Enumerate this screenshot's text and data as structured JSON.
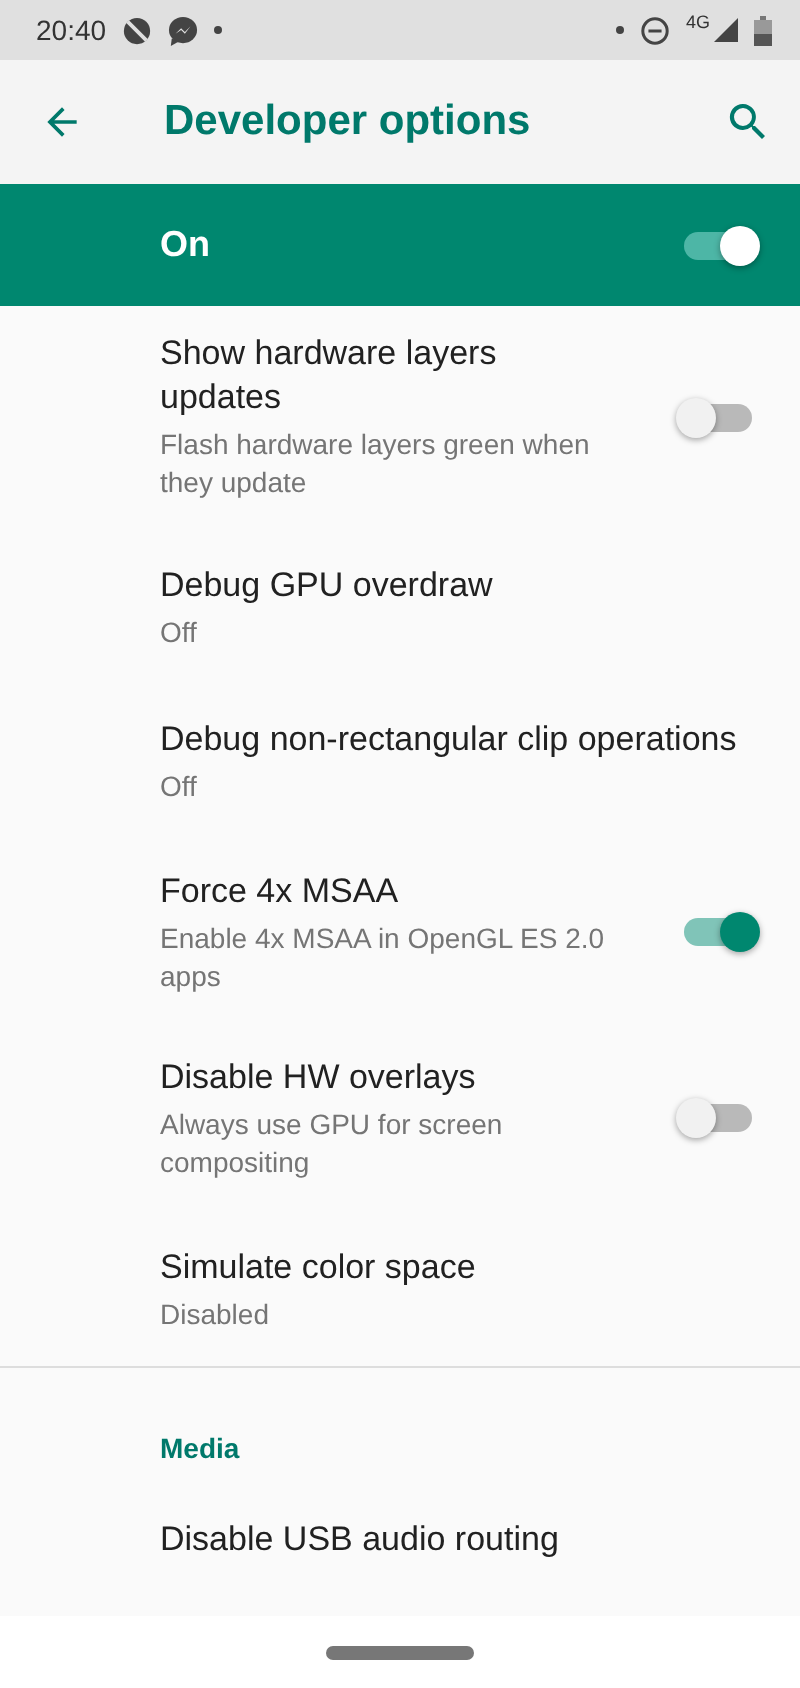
{
  "status_bar": {
    "time": "20:40",
    "network": "4G"
  },
  "toolbar": {
    "title": "Developer options"
  },
  "master_switch": {
    "label": "On",
    "on": true
  },
  "items": [
    {
      "kind": "switch",
      "title": "Show hardware layers updates",
      "summary": "Flash hardware layers green when they update",
      "on": false
    },
    {
      "kind": "plain",
      "title": "Debug GPU overdraw",
      "summary": "Off"
    },
    {
      "kind": "plain",
      "title": "Debug non-rectangular clip operations",
      "summary": "Off"
    },
    {
      "kind": "switch",
      "title": "Force 4x MSAA",
      "summary": "Enable 4x MSAA in OpenGL ES 2.0 apps",
      "on": true
    },
    {
      "kind": "switch",
      "title": "Disable HW overlays",
      "summary": "Always use GPU for screen compositing",
      "on": false
    },
    {
      "kind": "plain",
      "title": "Simulate color space",
      "summary": "Disabled"
    }
  ],
  "section": {
    "header": "Media",
    "items": [
      {
        "title": "Disable USB audio routing"
      }
    ]
  }
}
